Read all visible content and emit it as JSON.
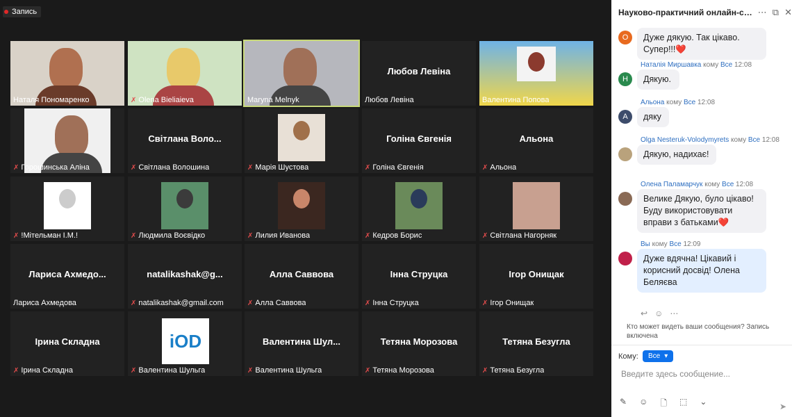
{
  "recording": {
    "label": "Запись"
  },
  "tiles": [
    {
      "name": "Наталя Пономаренко",
      "mode": "video"
    },
    {
      "name": "Olena Bieliaieva",
      "mode": "video",
      "muted": true
    },
    {
      "name": "Maryna Melnyk",
      "mode": "video",
      "active": true
    },
    {
      "name": "Любов Левіна",
      "mode": "text",
      "big": "Любов Левіна"
    },
    {
      "name": "Валентина Попова",
      "mode": "photo"
    },
    {
      "name": "Горошинська Аліна",
      "mode": "video",
      "muted": true
    },
    {
      "name": "Світлана Волошина",
      "mode": "text",
      "big": "Світлана Воло...",
      "muted": true
    },
    {
      "name": "Марія Шустова",
      "mode": "photo",
      "muted": true
    },
    {
      "name": "Голіна Євгенія",
      "mode": "text",
      "big": "Голіна Євгенія",
      "muted": true
    },
    {
      "name": "Альона",
      "mode": "text",
      "big": "Альона",
      "muted": true
    },
    {
      "name": "!Мітельман І.М.!",
      "mode": "photo",
      "muted": true
    },
    {
      "name": "Людмила Воєвідко",
      "mode": "photo",
      "muted": true
    },
    {
      "name": "Лилия Иванова",
      "mode": "photo",
      "muted": true
    },
    {
      "name": "Кедров Борис",
      "mode": "photo",
      "muted": true
    },
    {
      "name": "Світлана Нагорняк",
      "mode": "photo",
      "muted": true
    },
    {
      "name": "Лариса Ахмедова",
      "mode": "text",
      "big": "Лариса  Ахмедо..."
    },
    {
      "name": "natalikashak@gmail.com",
      "mode": "text",
      "big": "natalikashak@g...",
      "muted": true
    },
    {
      "name": "Алла Саввова",
      "mode": "text",
      "big": "Алла Саввова",
      "muted": true
    },
    {
      "name": "Інна Струцка",
      "mode": "text",
      "big": "Інна Струцка",
      "muted": true
    },
    {
      "name": "Ігор Онищак",
      "mode": "text",
      "big": "Ігор Онищак",
      "muted": true
    },
    {
      "name": "Ірина Складна",
      "mode": "text",
      "big": "Ірина Складна",
      "muted": true
    },
    {
      "name": "Валентина Шульга",
      "mode": "logo",
      "logo_text": "iOD",
      "muted": true
    },
    {
      "name": "Валентина Шульга",
      "mode": "text",
      "big": "Валентина  Шул...",
      "muted": true
    },
    {
      "name": "Тетяна Морозова",
      "mode": "text",
      "big": "Тетяна Морозова",
      "muted": true
    },
    {
      "name": "Тетяна Безугла",
      "mode": "text",
      "big": "Тетяна Безугла",
      "muted": true
    }
  ],
  "chat": {
    "title": "Науково-практичний онлайн-се...",
    "header_icons": [
      "more-icon",
      "popout-icon",
      "close-icon"
    ],
    "to_word": "кому",
    "everyone": "Все",
    "messages": [
      {
        "avatar_letter": "O",
        "avatar_color": "#e86a1f",
        "text": "Дуже дякую. Так цікаво. Супер!!!❤️"
      },
      {
        "sender": "Наталія Миршавка",
        "time": "12:08",
        "avatar_letter": "Н",
        "avatar_color": "#2a8a4e",
        "text": "Дякую."
      },
      {
        "sender": "Альона",
        "time": "12:08",
        "avatar_letter": "А",
        "avatar_color": "#3d4c6b",
        "text": "дяку"
      },
      {
        "sender": "Olga Nesteruk-Volodymyrets",
        "time": "12:08",
        "avatar_letter": "",
        "avatar_color": "#b9a27c",
        "text": "Дякую, надихає!"
      },
      {
        "sender": "Олена Паламарчук",
        "time": "12:08",
        "avatar_letter": "",
        "avatar_color": "#8a6a55",
        "text": "Велике Дякую, було цікаво! Буду використовувати вправи з батьками❤️"
      },
      {
        "sender": "Вы",
        "time": "12:09",
        "avatar_letter": "",
        "avatar_color": "#c0204a",
        "text": " Дуже вдячна!  Цікавий і корисний досвід! Олена Беляєва",
        "mine": true
      }
    ],
    "who_can_see": "Кто может видеть ваши сообщения? Запись включена",
    "to_label": "Кому:",
    "to_value": "Все",
    "input_placeholder": "Введите здесь сообщение..."
  }
}
